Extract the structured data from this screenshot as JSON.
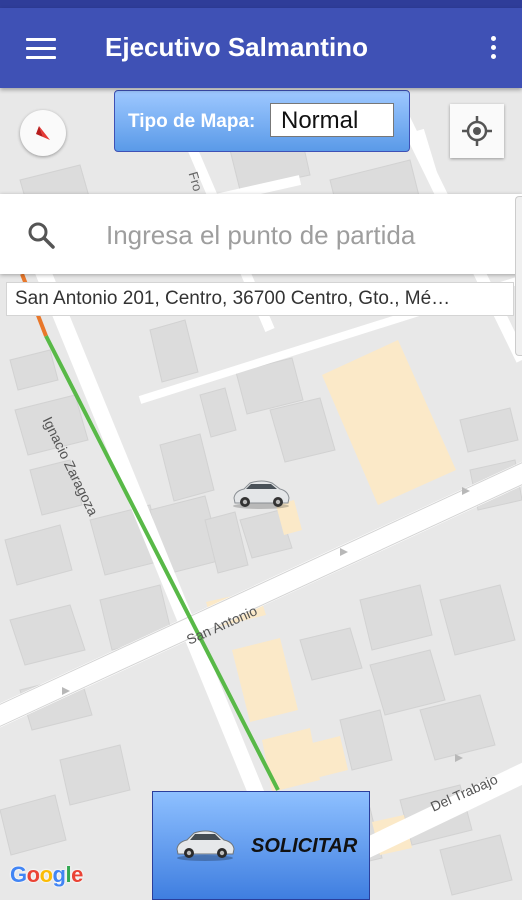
{
  "app": {
    "title": "Ejecutivo Salmantino",
    "menu_icon": "hamburger-menu-icon",
    "overflow_icon": "more-vert-icon",
    "accent_color": "#3f51b5"
  },
  "map_type": {
    "label": "Tipo de Mapa:",
    "selected": "Normal"
  },
  "search": {
    "icon": "search-icon",
    "placeholder": "Ingresa el punto de partida"
  },
  "address": "San Antonio 201, Centro, 36700 Centro, Gto., Mé…",
  "map": {
    "street_labels": [
      "Ignacio Zaragoza",
      "San Antonio",
      "Del Trabajo",
      "Fro"
    ],
    "compass_icon": "compass-icon",
    "locate_icon": "my-location-icon",
    "marker_icon": "car-icon"
  },
  "request_button": {
    "label": "SOLICITAR",
    "icon": "car-icon"
  },
  "attribution": {
    "letters": [
      "G",
      "o",
      "o",
      "g",
      "l",
      "e"
    ],
    "colors": [
      "#4285f4",
      "#ea4335",
      "#fbbc05",
      "#4285f4",
      "#34a853",
      "#ea4335"
    ]
  }
}
